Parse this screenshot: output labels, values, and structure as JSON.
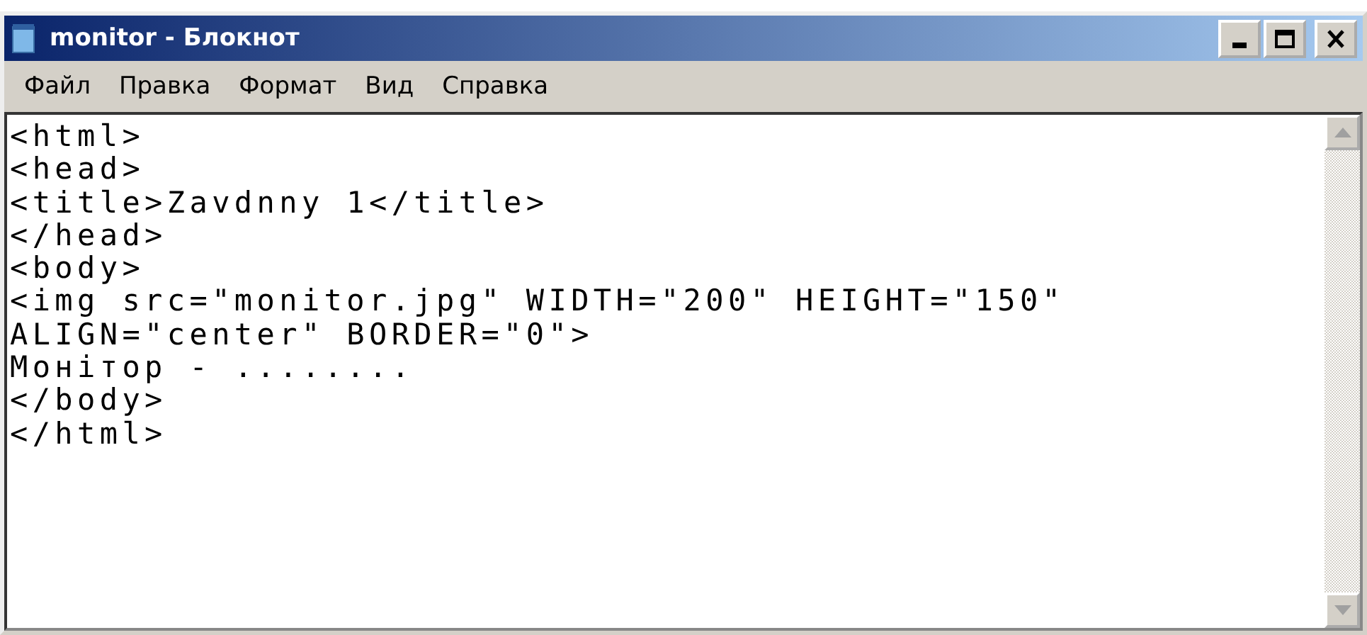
{
  "window": {
    "title": "monitor - Блокнот"
  },
  "menu": [
    "Файл",
    "Правка",
    "Формат",
    "Вид",
    "Справка"
  ],
  "editor": {
    "lines": [
      "<html>",
      "<head>",
      "<title>Zavdnny 1</title>",
      "</head>",
      "<body>",
      "<img src=\"monitor.jpg\" WIDTH=\"200\" HEIGHT=\"150\"",
      "ALIGN=\"center\" BORDER=\"0\">",
      "Монітор - ........",
      "</body>",
      "</html>"
    ]
  }
}
